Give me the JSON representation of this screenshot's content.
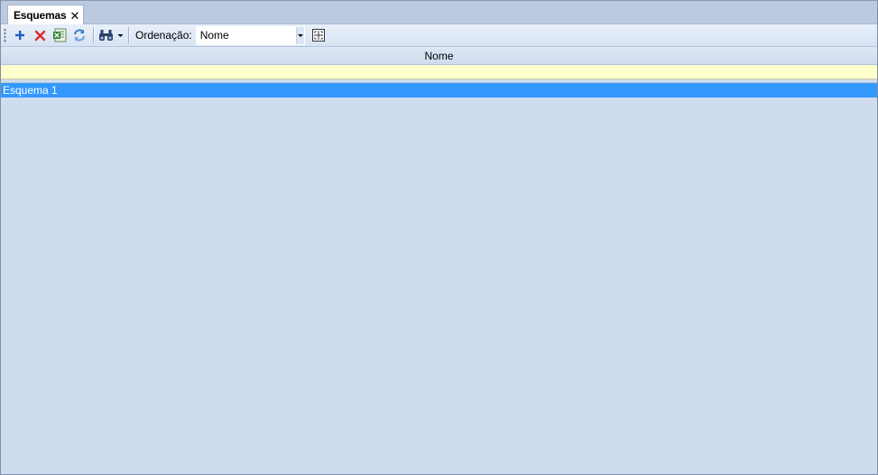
{
  "tab": {
    "title": "Esquemas",
    "close_glyph": "✕"
  },
  "toolbar": {
    "buttons": [
      {
        "icon": "add-icon",
        "color": "#1f5fbf"
      },
      {
        "icon": "delete-icon",
        "color": "#e02b2b"
      },
      {
        "icon": "excel-export-icon",
        "color": "#2f7d32"
      },
      {
        "icon": "refresh-icon",
        "color": "#3a78c4"
      },
      {
        "icon": "binoculars-icon",
        "color": "#2b3f66"
      }
    ],
    "sort_label": "Ordenação:",
    "sort_value": "Nome"
  },
  "grid": {
    "columns": [
      "Nome"
    ],
    "rows": [
      {
        "nome": "Esquema 1",
        "selected": true
      }
    ],
    "colors": {
      "selected_row": "#3399ff",
      "filter_row": "#ffffcc",
      "background": "#cfdced"
    }
  }
}
